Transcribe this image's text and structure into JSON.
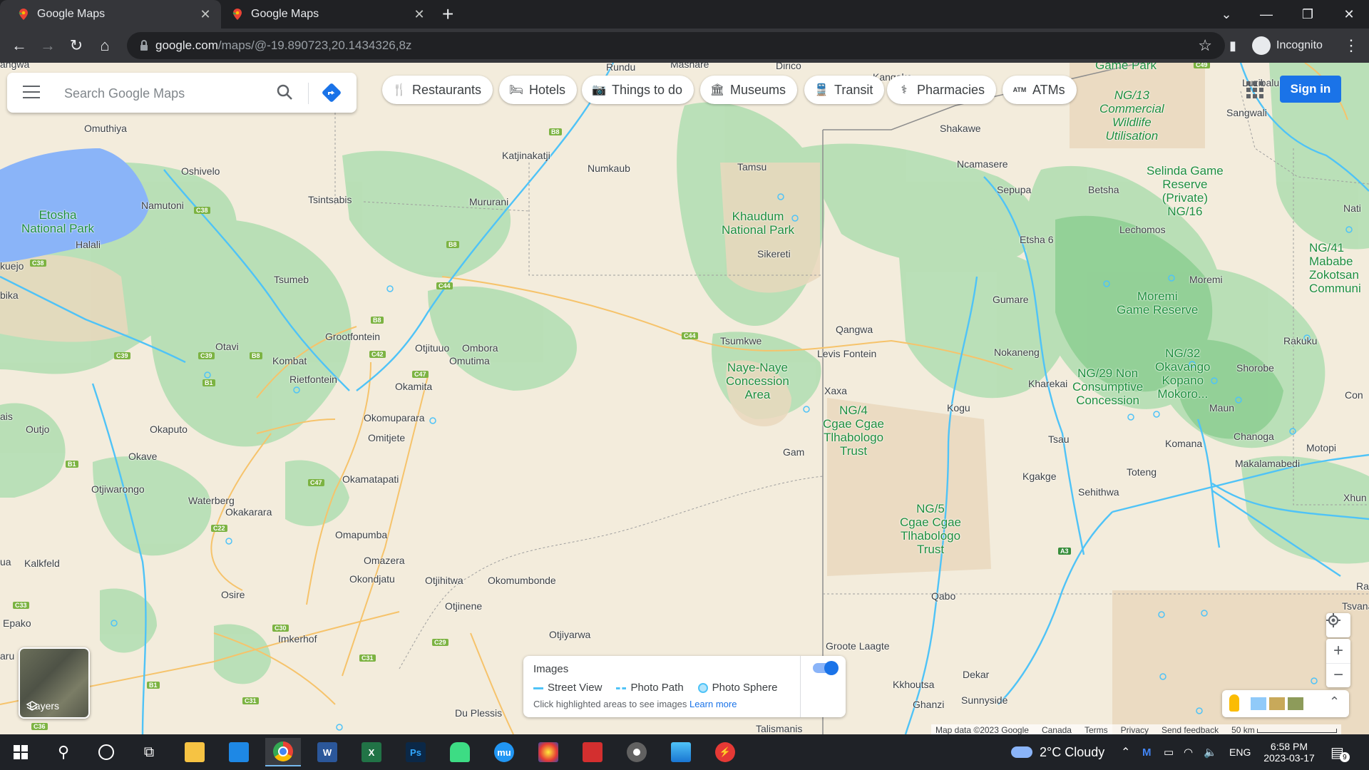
{
  "browser": {
    "tabs": [
      {
        "title": "Google Maps",
        "active": true
      },
      {
        "title": "Google Maps",
        "active": false
      }
    ],
    "new_tab": "+",
    "url_host": "google.com",
    "url_path": "/maps/@-19.890723,20.1434326,8z",
    "profile": "Incognito"
  },
  "maps": {
    "search_placeholder": "Search Google Maps",
    "chips": [
      {
        "label": "Restaurants",
        "icon": "restaurant-icon"
      },
      {
        "label": "Hotels",
        "icon": "hotel-icon"
      },
      {
        "label": "Things to do",
        "icon": "camera-icon"
      },
      {
        "label": "Museums",
        "icon": "museum-icon"
      },
      {
        "label": "Transit",
        "icon": "transit-icon"
      },
      {
        "label": "Pharmacies",
        "icon": "pharmacy-icon"
      },
      {
        "label": "ATMs",
        "icon": "atm-icon"
      }
    ],
    "sign_in": "Sign in",
    "layers_label": "Layers",
    "images_panel": {
      "title": "Images",
      "legend": [
        "Street View",
        "Photo Path",
        "Photo Sphere"
      ],
      "note": "Click highlighted areas to see images",
      "learn_more": "Learn more",
      "toggle_on": true
    },
    "footer": {
      "map_data": "Map data ©2023 Google",
      "country": "Canada",
      "terms": "Terms",
      "privacy": "Privacy",
      "feedback": "Send feedback",
      "scale": "50 km"
    },
    "places": {
      "angwa": "angwa",
      "rundu": "Rundu",
      "mashare": "Mashare",
      "dirico": "Dirico",
      "kangoko": "Kangoko",
      "omuthiya": "Omuthiya",
      "oshivelo": "Oshivelo",
      "katjinakatji": "Katjinakatji",
      "numkaub": "Numkaub",
      "tamsu": "Tamsu",
      "namutoni": "Namutoni",
      "tsintsabis": "Tsintsabis",
      "mururani": "Mururani",
      "halali": "Halali",
      "kuejo": "kuejo",
      "tsumeb": "Tsumeb",
      "bika": "bika",
      "grootfontein": "Grootfontein",
      "otavi": "Otavi",
      "kombat": "Kombat",
      "rietfontein": "Rietfontein",
      "otjituuo": "Otjituuo",
      "ombora": "Ombora",
      "omutima": "Omutima",
      "okamita": "Okamita",
      "tsumkwe": "Tsumkwe",
      "qangwa": "Qangwa",
      "levis": "Levis Fontein",
      "xaxa": "Xaxa",
      "kogu": "Kogu",
      "gam": "Gam",
      "ais": "ais",
      "outjo": "Outjo",
      "okaputo": "Okaputo",
      "okomuparara": "Okomuparara",
      "omitjete": "Omitjete",
      "okave": "Okave",
      "okamatapati": "Okamatapati",
      "otjiwarongo": "Otjiwarongo",
      "waterberg": "Waterberg",
      "okakarara": "Okakarara",
      "omapumba": "Omapumba",
      "omazera": "Omazera",
      "okondjatu": "Okondjatu",
      "otjihitwa": "Otjihitwa",
      "okomumbonde": "Okomumbonde",
      "kalkfeld": "Kalkfeld",
      "ua": "ua",
      "osire": "Osire",
      "otjinene": "Otjinene",
      "epako": "Epako",
      "imkerhof": "Imkerhof",
      "otjiyarwa": "Otjiyarwa",
      "aru": "aru",
      "dup": "Du Plessis",
      "talismanis": "Talismanis",
      "groote": "Groote Laagte",
      "kkhoutsa": "Kkhoutsa",
      "ghanzi": "Ghanzi",
      "dekar": "Dekar",
      "sunnyside": "Sunnyside",
      "qabo": "Qabo",
      "shakawe": "Shakawe",
      "ncamasere": "Ncamasere",
      "sepupa": "Sepupa",
      "betsha": "Betsha",
      "etsha": "Etsha 6",
      "lechomos": "Lechomos",
      "gumare": "Gumare",
      "nokaneng": "Nokaneng",
      "kharekai": "Kharekai",
      "tsau": "Tsau",
      "kgakge": "Kgakge",
      "sehithwa": "Sehithwa",
      "toteng": "Toteng",
      "komana": "Komana",
      "maun": "Maun",
      "chanoga": "Chanoga",
      "makalamabedi": "Makalamabedi",
      "motopi": "Motopi",
      "xhun": "Xhun",
      "rakuku": "Rakuku",
      "shorobe": "Shorobe",
      "moremi_t": "Moremi",
      "sangwali": "Sangwali",
      "luzibalula": "Luzibalula",
      "ra": "Ra",
      "tsvanat": "Tsvanat",
      "con": "Con",
      "nati": "Nati"
    },
    "areas": {
      "etosha": "Etosha\nNational Park",
      "khaudum": "Khaudum\nNational Park",
      "sikereti": "Sikereti",
      "nayenaye": "Naye-Naye\nConcession\nArea",
      "ng4": "NG/4\nCgae Cgae\nTlhabologo\nTrust",
      "ng5": "NG/5\nCgae Cgae\nTlhabologo\nTrust",
      "ng13": "NG/13\nCommercial\nWildlife\nUtilisation",
      "selinda": "Selinda Game\nReserve\n(Private)\nNG/16",
      "moremi": "Moremi\nGame Reserve",
      "ng29": "NG/29 Non\nConsumptive\nConcession",
      "ng32": "NG/32\nOkavango\nKopano\nMokoro...",
      "ng41": "NG/41\nMababe\nZokotsan\nCommuni",
      "gamepark": "Game Park"
    },
    "roads": {
      "b8a": "B8",
      "b8b": "B8",
      "b8c": "B8",
      "b8d": "B8",
      "c38a": "C38",
      "c38b": "C38",
      "c44a": "C44",
      "c44b": "C44",
      "c39a": "C39",
      "c39b": "C39",
      "b1a": "B1",
      "b1b": "B1",
      "b1c": "B1",
      "c42": "C42",
      "c47a": "C47",
      "c47b": "C47",
      "c22": "C22",
      "c30": "C30",
      "c29": "C29",
      "c31a": "C31",
      "c31b": "C31",
      "c33": "C33",
      "c36": "C36",
      "a3": "A3",
      "c49": "C49"
    }
  },
  "taskbar": {
    "weather": "2°C  Cloudy",
    "lang": "ENG",
    "time": "6:58 PM",
    "date": "2023-03-17",
    "notifications": "9"
  }
}
